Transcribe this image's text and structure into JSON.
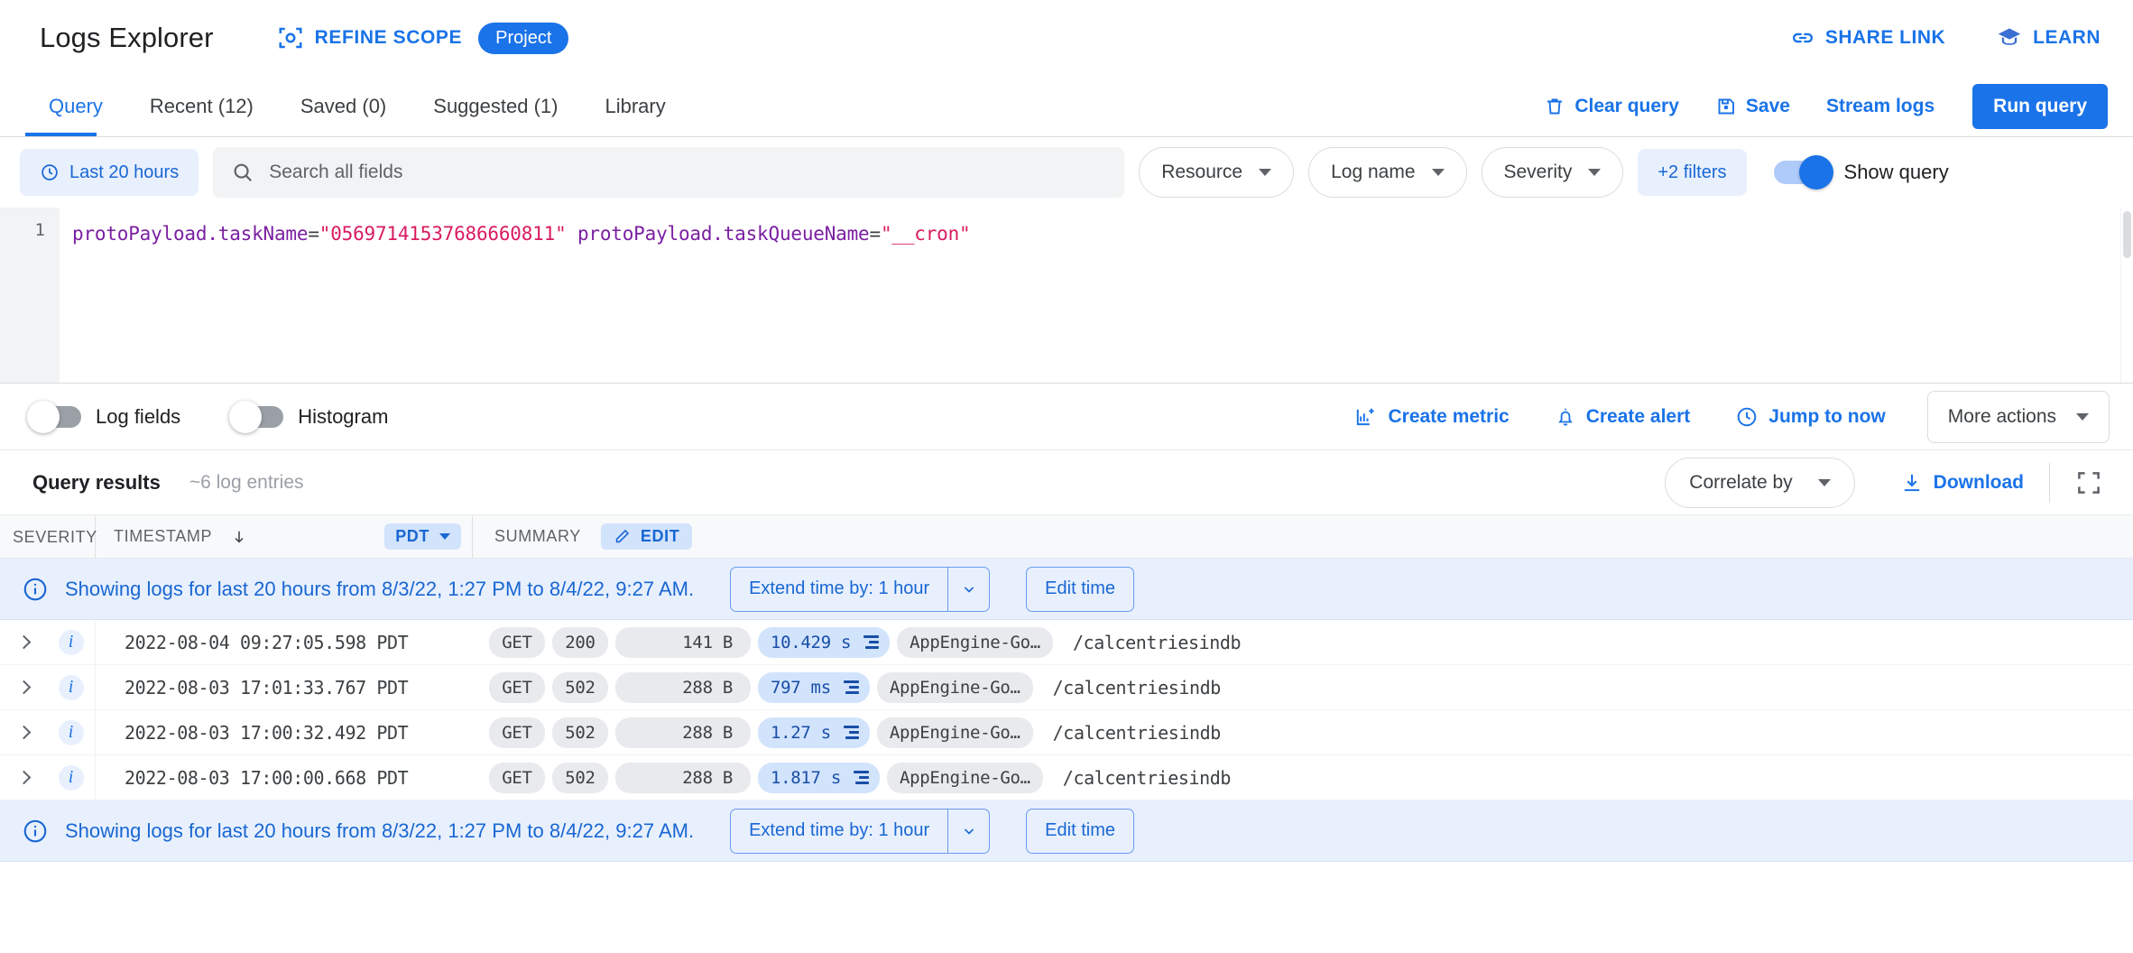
{
  "header": {
    "title": "Logs Explorer",
    "refine_scope_label": "REFINE SCOPE",
    "scope_chip": "Project",
    "share_link": "SHARE LINK",
    "learn": "LEARN"
  },
  "tabs": [
    {
      "label": "Query",
      "active": true
    },
    {
      "label": "Recent (12)",
      "active": false
    },
    {
      "label": "Saved (0)",
      "active": false
    },
    {
      "label": "Suggested (1)",
      "active": false
    },
    {
      "label": "Library",
      "active": false
    }
  ],
  "tab_actions": {
    "clear_query": "Clear query",
    "save": "Save",
    "stream_logs": "Stream logs",
    "run_query": "Run query"
  },
  "filterbar": {
    "time_range": "Last 20 hours",
    "search_placeholder": "Search all fields",
    "search_value": "",
    "resource": "Resource",
    "log_name": "Log name",
    "severity": "Severity",
    "more_filters": "+2 filters",
    "show_query_label": "Show query",
    "show_query_on": true
  },
  "editor": {
    "line_number": "1",
    "tokens": [
      {
        "type": "field",
        "text": "protoPayload.taskName"
      },
      {
        "type": "op",
        "text": "="
      },
      {
        "type": "str",
        "text": "\"05697141537686660811\""
      },
      {
        "type": "op",
        "text": " "
      },
      {
        "type": "field",
        "text": "protoPayload.taskQueueName"
      },
      {
        "type": "op",
        "text": "="
      },
      {
        "type": "str",
        "text": "\"__cron\""
      }
    ],
    "full_query": "protoPayload.taskName=\"05697141537686660811\" protoPayload.taskQueueName=\"__cron\""
  },
  "actionsbar": {
    "log_fields_label": "Log fields",
    "log_fields_on": false,
    "histogram_label": "Histogram",
    "histogram_on": false,
    "create_metric": "Create metric",
    "create_alert": "Create alert",
    "jump_to_now": "Jump to now",
    "more_actions": "More actions"
  },
  "results": {
    "title": "Query results",
    "count": "~6 log entries",
    "correlate_by": "Correlate by",
    "download": "Download"
  },
  "table": {
    "columns": {
      "severity": "SEVERITY",
      "timestamp": "TIMESTAMP",
      "timezone": "PDT",
      "summary": "SUMMARY",
      "edit": "EDIT"
    },
    "banner": {
      "text": "Showing logs for last 20 hours from 8/3/22, 1:27 PM to 8/4/22, 9:27 AM.",
      "extend_label": "Extend time by: 1 hour",
      "edit_time_label": "Edit time"
    },
    "rows": [
      {
        "severity": "info",
        "timestamp": "2022-08-04 09:27:05.598 PDT",
        "method": "GET",
        "status": "200",
        "size": "141 B",
        "latency": "10.429 s",
        "agent": "AppEngine-Go…",
        "path": "/calcentriesindb"
      },
      {
        "severity": "info",
        "timestamp": "2022-08-03 17:01:33.767 PDT",
        "method": "GET",
        "status": "502",
        "size": "288 B",
        "latency": "797 ms",
        "agent": "AppEngine-Go…",
        "path": "/calcentriesindb"
      },
      {
        "severity": "info",
        "timestamp": "2022-08-03 17:00:32.492 PDT",
        "method": "GET",
        "status": "502",
        "size": "288 B",
        "latency": "1.27 s",
        "agent": "AppEngine-Go…",
        "path": "/calcentriesindb"
      },
      {
        "severity": "info",
        "timestamp": "2022-08-03 17:00:00.668 PDT",
        "method": "GET",
        "status": "502",
        "size": "288 B",
        "latency": "1.817 s",
        "agent": "AppEngine-Go…",
        "path": "/calcentriesindb"
      }
    ]
  },
  "colors": {
    "accent": "#1a73e8",
    "accent_dark": "#1967d2",
    "chip_bg": "#e8f0fe",
    "latency_pill": "#d2e3fc",
    "pill_bg": "#e8eaed",
    "text": "#202124",
    "muted": "#5f6368",
    "query_string": "#d81b60",
    "query_field": "#7b1fa2"
  }
}
